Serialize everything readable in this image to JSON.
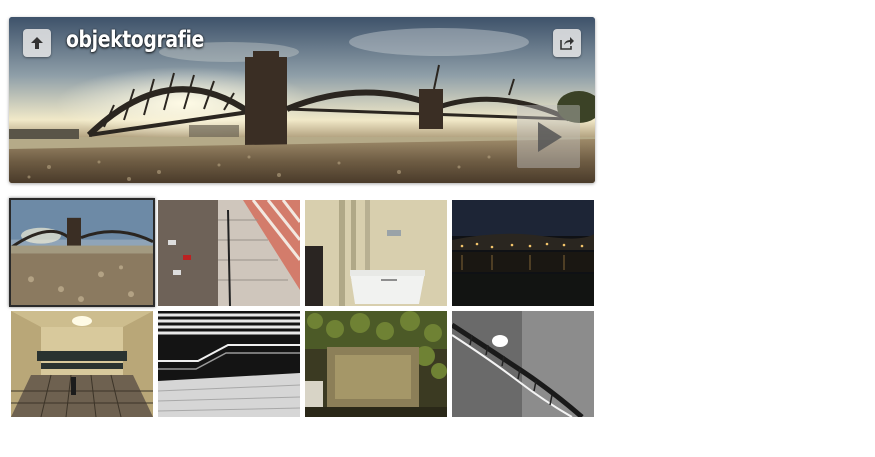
{
  "header": {
    "title": "objektografie",
    "up_icon": "arrow-up-icon",
    "share_icon": "share-icon",
    "play_icon": "play-icon"
  },
  "gallery": {
    "selected_index": 0,
    "thumbnails": [
      {
        "subject": "bridge"
      },
      {
        "subject": "stairs-from-above"
      },
      {
        "subject": "sink"
      },
      {
        "subject": "city-night"
      },
      {
        "subject": "underground-corridor"
      },
      {
        "subject": "stair-railing"
      },
      {
        "subject": "ivy-wall"
      },
      {
        "subject": "spiral-staircase"
      }
    ]
  },
  "colors": {
    "title_text": "#ffffff",
    "button_bg": "#e6e6e6",
    "selected_border": "#2a2a2a"
  }
}
